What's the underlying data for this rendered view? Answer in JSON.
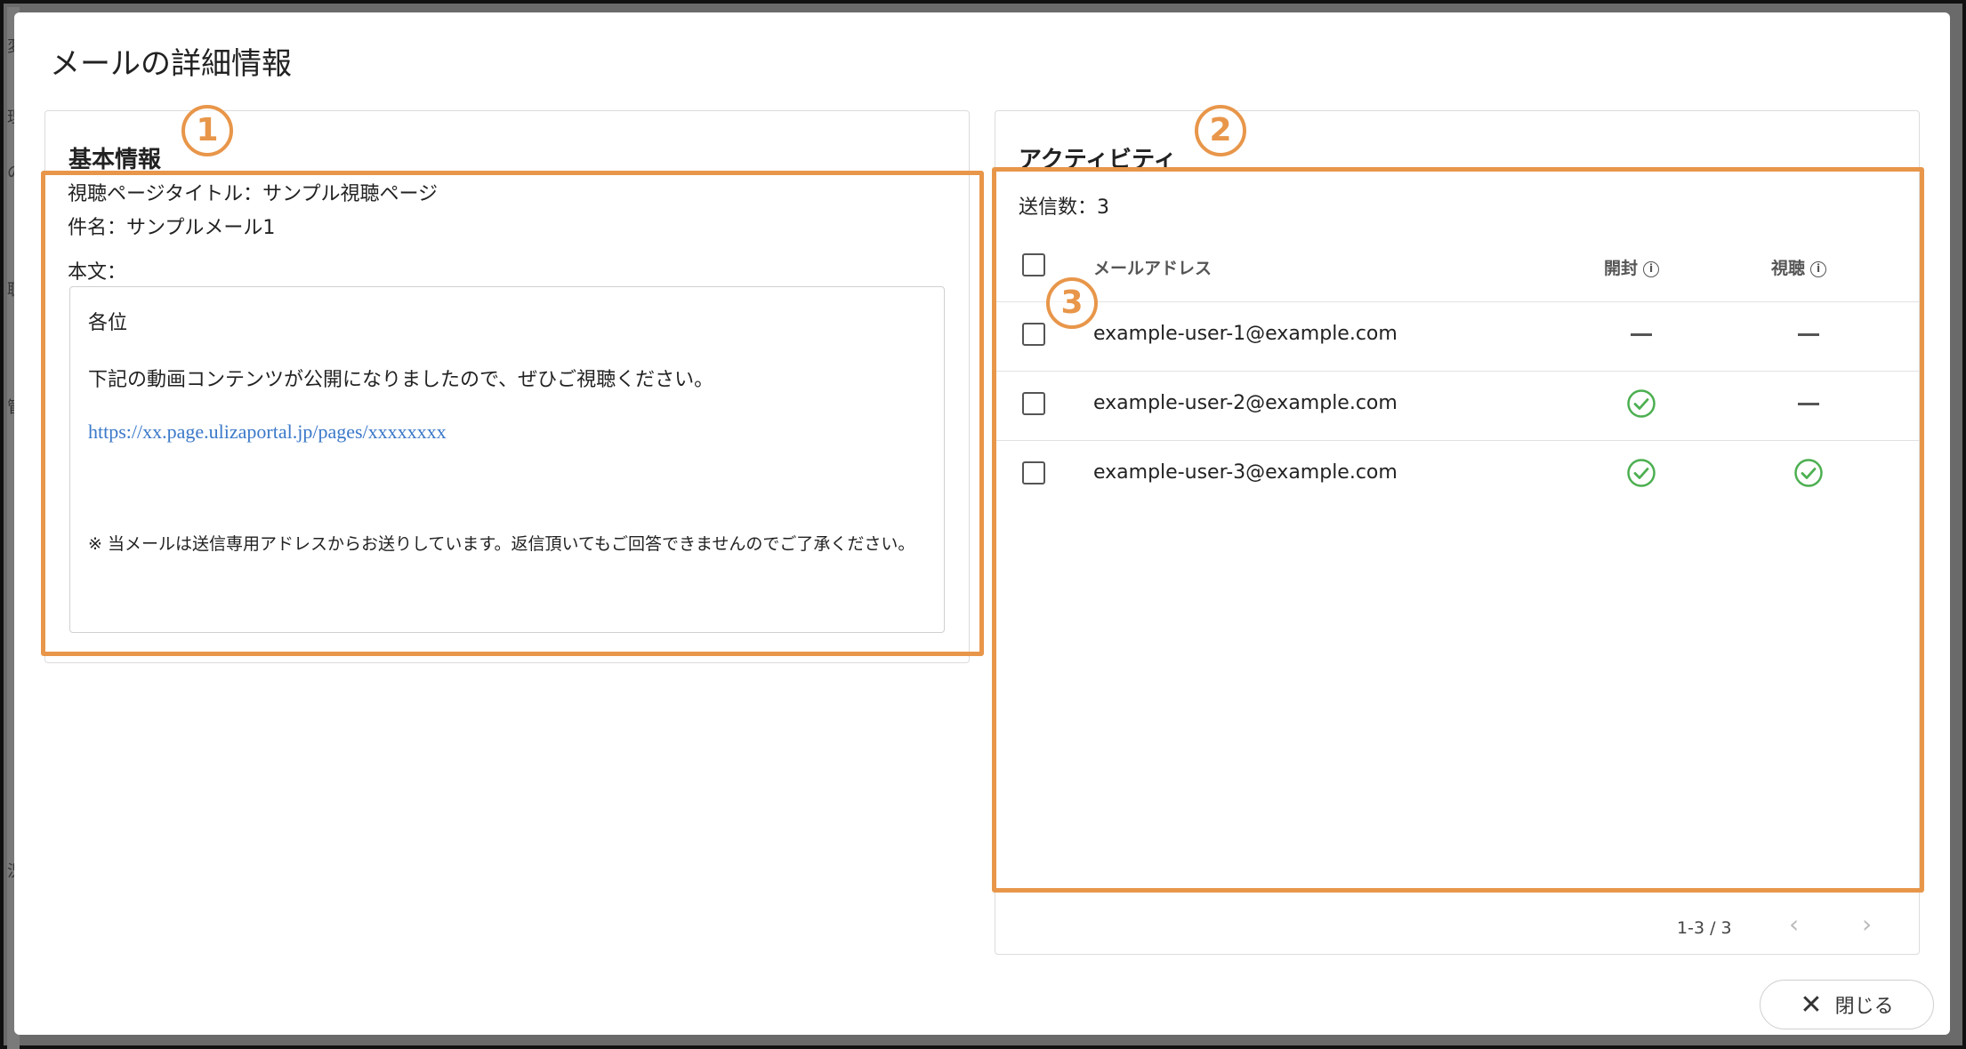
{
  "dialog": {
    "title": "メールの詳細情報"
  },
  "basic": {
    "title": "基本情報",
    "callout": "1",
    "page_title_line": "視聴ページタイトル：サンプル視聴ページ",
    "subject_line": "件名：サンプルメール1",
    "body_label": "本文：",
    "body": {
      "greeting": "各位",
      "line1": "下記の動画コンテンツが公開になりましたので、ぜひご視聴ください。",
      "link": "https://xx.page.ulizaportal.jp/pages/xxxxxxxx",
      "note": "※ 当メールは送信専用アドレスからお送りしています。返信頂いてもご回答できませんのでご了承ください。"
    }
  },
  "activity": {
    "title": "アクティビティ",
    "callout": "2",
    "row_callout": "3",
    "sent_count": "送信数：3",
    "columns": {
      "email": "メールアドレス",
      "opened": "開封",
      "viewed": "視聴"
    },
    "rows": [
      {
        "email": "example-user-1@example.com",
        "opened": false,
        "viewed": false
      },
      {
        "email": "example-user-2@example.com",
        "opened": true,
        "viewed": false
      },
      {
        "email": "example-user-3@example.com",
        "opened": true,
        "viewed": true
      }
    ],
    "pagination": "1-3 / 3"
  },
  "footer": {
    "close_label": "閉じる"
  },
  "colors": {
    "highlight": "#e8964a",
    "check": "#4caf50",
    "link": "#3a78c9"
  },
  "backdrop_chars": [
    "変",
    "理",
    "の",
    "聴",
    "管",
    "況"
  ]
}
